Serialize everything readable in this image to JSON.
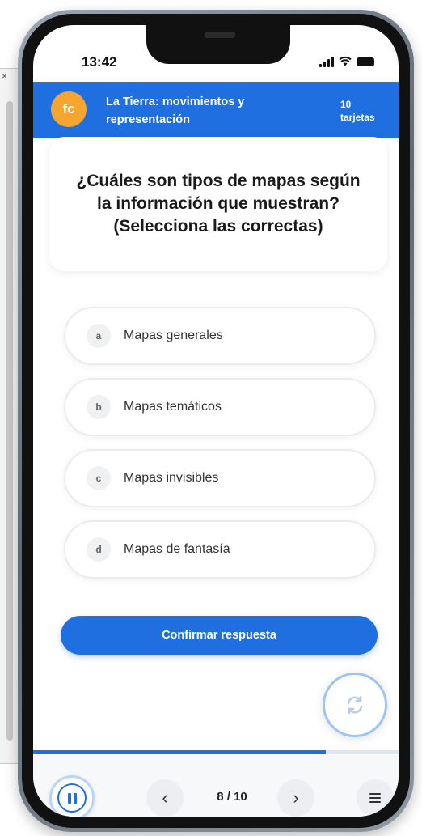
{
  "status_bar": {
    "time": "13:42"
  },
  "header": {
    "logo_text": "fc",
    "title": "La Tierra: movimientos y representación",
    "count_number": "10",
    "count_label": "tarjetas"
  },
  "question": {
    "text": "¿Cuáles son tipos de mapas según la información que muestran? (Selecciona las correctas)"
  },
  "options": [
    {
      "letter": "a",
      "label": "Mapas generales"
    },
    {
      "letter": "b",
      "label": "Mapas temáticos"
    },
    {
      "letter": "c",
      "label": "Mapas invisibles"
    },
    {
      "letter": "d",
      "label": "Mapas de fantasía"
    }
  ],
  "actions": {
    "confirm_label": "Confirmar respuesta"
  },
  "progress": {
    "fraction": 0.8
  },
  "navigation": {
    "page_counter": "8 / 10",
    "prev_glyph": "‹",
    "next_glyph": "›"
  },
  "colors": {
    "accent": "#1f6fe0",
    "logo": "#f6a531"
  },
  "icons": {
    "flip": "refresh-icon",
    "pause": "pause-icon",
    "menu": "hamburger-menu-icon"
  }
}
